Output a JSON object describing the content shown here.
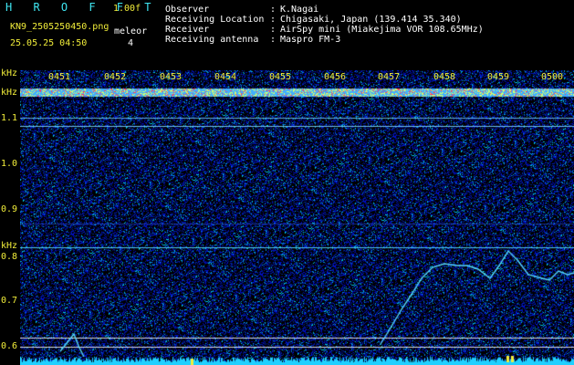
{
  "header": {
    "brand": "H R O F F T",
    "version": "1.00f",
    "filename": "KN9_2505250450.png",
    "mode": "meleor",
    "datetime": "25.05.25 04:50",
    "count": "4",
    "meta": [
      {
        "label": "Observer",
        "value": "K.Nagai"
      },
      {
        "label": "Receiving Location",
        "value": "Chigasaki, Japan (139.414 35.340)"
      },
      {
        "label": "Receiver",
        "value": "AirSpy mini (Miakejima VOR 108.65MHz)"
      },
      {
        "label": "Receiving antenna",
        "value": "Maspro FM-3"
      }
    ],
    "colon": ":"
  },
  "spectrogram": {
    "unit": "kHz",
    "time_ticks": [
      "0451",
      "0452",
      "0453",
      "0454",
      "0455",
      "0456",
      "0457",
      "0458",
      "0459",
      "0500"
    ],
    "freq_labels": [
      "1.1",
      "1.0",
      "0.9",
      "0.8",
      "0.7",
      "0.6"
    ],
    "colors": {
      "noise": "#1a2fbf",
      "line": "#56d9ff",
      "hot": "#ff3040",
      "grid": "#ffffff",
      "label": "#f2ee3a"
    }
  }
}
